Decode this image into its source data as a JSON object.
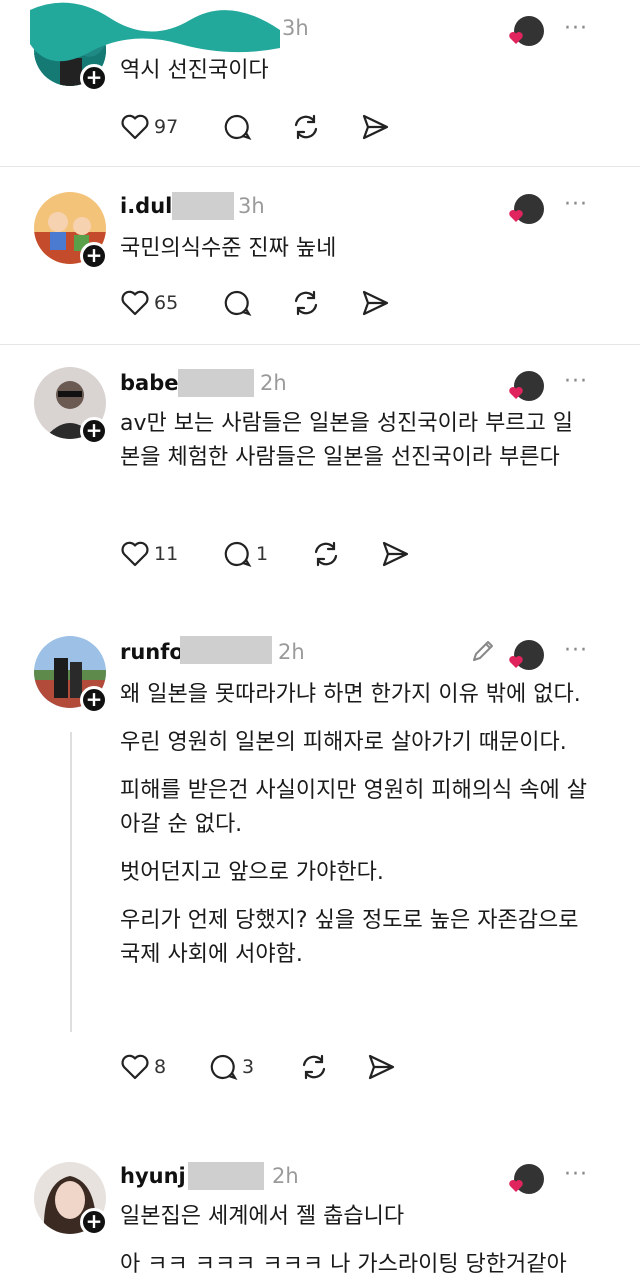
{
  "posts": [
    {
      "username": "",
      "time": "3h",
      "text": [
        "역시 선진국이다"
      ],
      "likes": "97",
      "replies": ""
    },
    {
      "username": "i.dul",
      "time": "3h",
      "text": [
        "국민의식수준 진짜 높네"
      ],
      "likes": "65",
      "replies": ""
    },
    {
      "username": "babe",
      "time": "2h",
      "text": [
        "av만 보는 사람들은 일본을 성진국이라 부르고 일본을 체험한 사람들은 일본을 선진국이라 부른다"
      ],
      "likes": "11",
      "replies": "1"
    },
    {
      "username": "runfo",
      "time": "2h",
      "text": [
        "왜 일본을 못따라가냐 하면 한가지 이유 밖에 없다.",
        "우린 영원히 일본의 피해자로 살아가기 때문이다.",
        "피해를 받은건 사실이지만 영원히 피해의식 속에 살아갈 순 없다.",
        "벗어던지고 앞으로 가야한다.",
        "우리가 언제 당했지? 싶을 정도로 높은 자존감으로 국제 사회에 서야함."
      ],
      "likes": "8",
      "replies": "3"
    },
    {
      "username": "hyunj",
      "time": "2h",
      "text": [
        "일본집은 세계에서 젤 춥습니다",
        "아 ㅋㅋ ㅋㅋㅋ ㅋㅋㅋ 나 가스라이팅 당한거같아"
      ],
      "likes": "",
      "replies": ""
    }
  ],
  "icons": {
    "like": "heart-icon",
    "reply": "comment-icon",
    "repost": "repost-icon",
    "share": "send-icon",
    "more": "more-icon",
    "edit": "pencil-icon",
    "plus": "plus-icon"
  },
  "more_label": "···",
  "plus_label": "+",
  "colors": {
    "heart": "#e0245e",
    "muted": "#9a9a9a"
  }
}
